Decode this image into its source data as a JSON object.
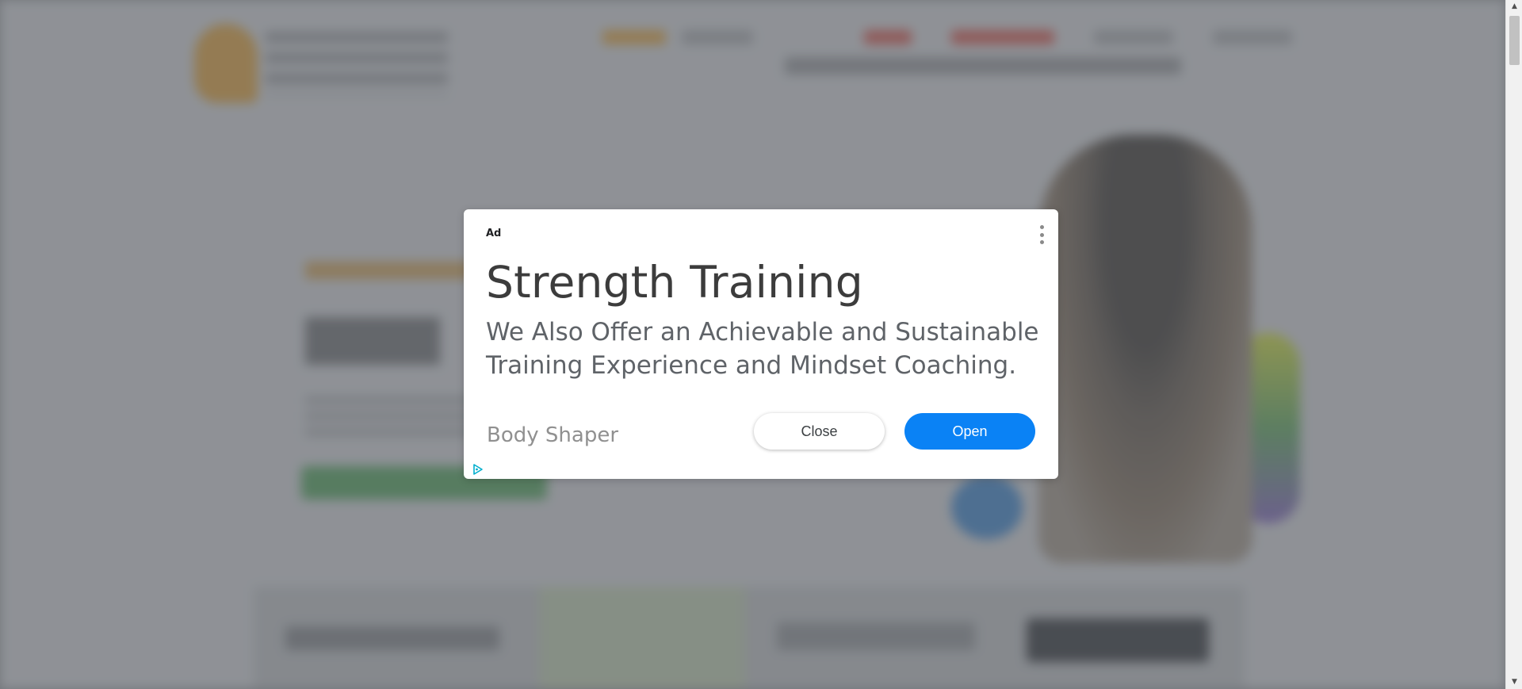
{
  "ad": {
    "label": "Ad",
    "headline": "Strength Training",
    "body": "We Also Offer an Achievable and Sustainable Training Experience and Mindset Coaching.",
    "advertiser": "Body Shaper",
    "close_label": "Close",
    "open_label": "Open",
    "menu_icon": "kebab-menu-icon",
    "choices_icon": "adchoices-icon",
    "open_color": "#0a82f5",
    "choices_color": "#00aecd"
  },
  "overlay": {
    "color": "#8a8d91"
  }
}
